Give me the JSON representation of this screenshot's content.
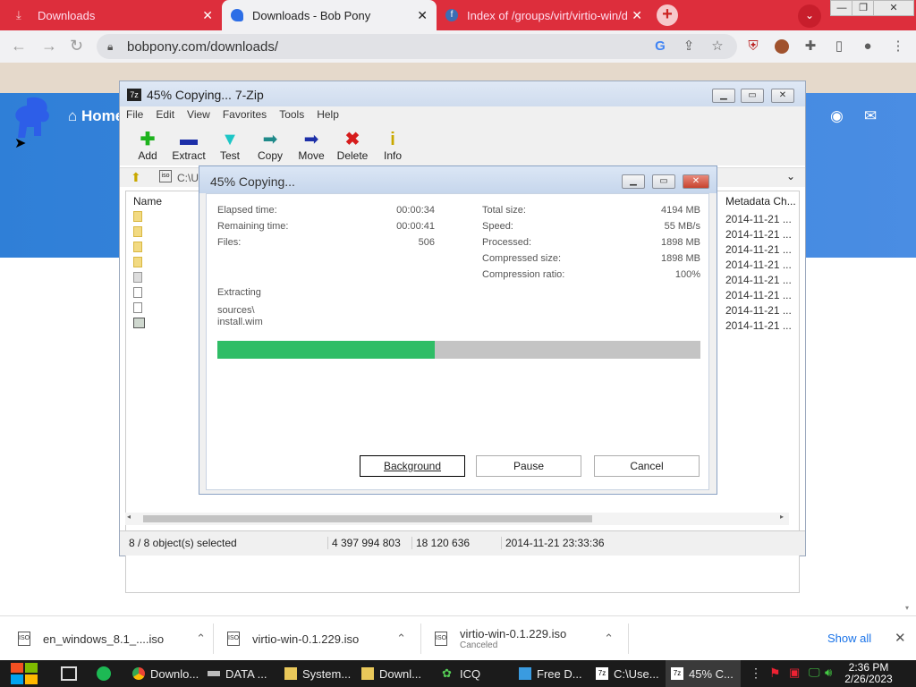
{
  "browser": {
    "tabs": [
      {
        "title": "Downloads",
        "active": false
      },
      {
        "title": "Downloads - Bob Pony",
        "active": true
      },
      {
        "title": "Index of /groups/virt/virtio-win/d",
        "active": false
      }
    ],
    "new_tab": "+",
    "url": "bobpony.com/downloads/"
  },
  "site": {
    "home_label": "Home"
  },
  "zip": {
    "title": "45% Copying... 7-Zip",
    "menu": [
      "File",
      "Edit",
      "View",
      "Favorites",
      "Tools",
      "Help"
    ],
    "tools": [
      "Add",
      "Extract",
      "Test",
      "Copy",
      "Move",
      "Delete",
      "Info"
    ],
    "address": "C:\\U",
    "col_name": "Name",
    "col_meta": "Metadata Ch...",
    "meta_rows": [
      "2014-11-21 ...",
      "2014-11-21 ...",
      "2014-11-21 ...",
      "2014-11-21 ...",
      "2014-11-21 ...",
      "2014-11-21 ...",
      "2014-11-21 ...",
      "2014-11-21 ..."
    ],
    "status": {
      "selected": "8 / 8 object(s) selected",
      "size": "4 397 994 803",
      "packed": "18 120 636",
      "date": "2014-11-21 23:33:36"
    }
  },
  "dialog": {
    "title": "45% Copying...",
    "left": [
      {
        "label": "Elapsed time:",
        "value": "00:00:34"
      },
      {
        "label": "Remaining time:",
        "value": "00:00:41"
      },
      {
        "label": "Files:",
        "value": "506"
      }
    ],
    "right": [
      {
        "label": "Total size:",
        "value": "4194 MB"
      },
      {
        "label": "Speed:",
        "value": "55 MB/s"
      },
      {
        "label": "Processed:",
        "value": "1898 MB"
      },
      {
        "label": "Compressed size:",
        "value": "1898 MB"
      },
      {
        "label": "Compression ratio:",
        "value": "100%"
      }
    ],
    "action": "Extracting",
    "path_line1": "sources\\",
    "path_line2": "install.wim",
    "progress": 0.45,
    "buttons": {
      "background": "Background",
      "pause": "Pause",
      "cancel": "Cancel"
    }
  },
  "downloads": {
    "items": [
      {
        "name": "en_windows_8.1_....iso",
        "sub": ""
      },
      {
        "name": "virtio-win-0.1.229.iso",
        "sub": ""
      },
      {
        "name": "virtio-win-0.1.229.iso",
        "sub": "Canceled"
      }
    ],
    "show_all": "Show all",
    "icon_label": "ISO"
  },
  "taskbar": {
    "items": [
      "Downlo...",
      "DATA ...",
      "System...",
      "Downl...",
      "ICQ",
      "Free D...",
      "C:\\Use...",
      "45% C..."
    ],
    "time": "2:36 PM",
    "date": "2/26/2023"
  },
  "colors": {
    "chrome_tab": "#dd2e3c",
    "progress": "#2fbd66",
    "hero": "#2f7fd7"
  }
}
